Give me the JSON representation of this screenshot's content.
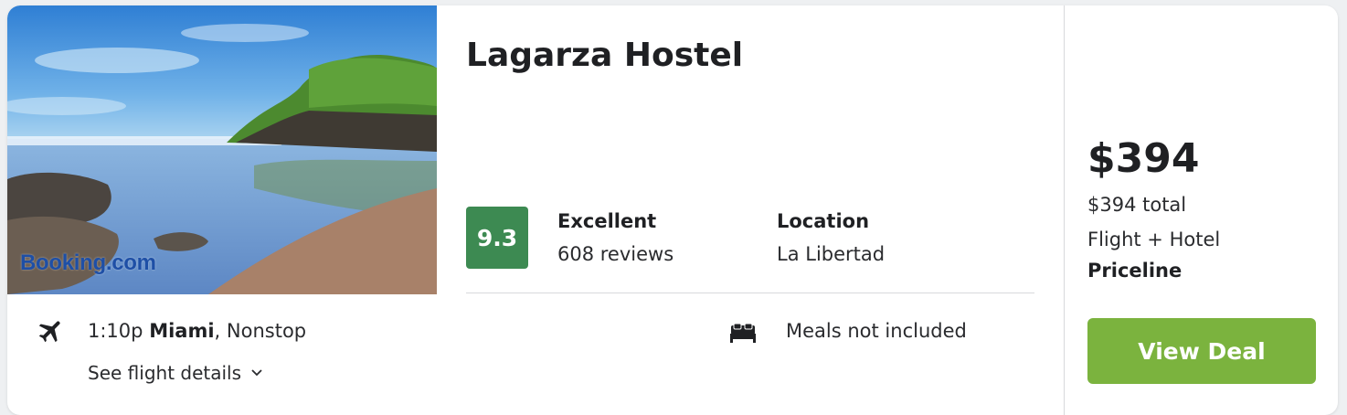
{
  "hotel": {
    "name": "Lagarza Hostel",
    "photo_watermark": "Booking.com",
    "score": "9.3",
    "rating_word": "Excellent",
    "review_count": "608 reviews",
    "location_label": "Location",
    "location_value": "La Libertad"
  },
  "flight": {
    "time": "1:10p",
    "origin": "Miami",
    "stops": ", Nonstop",
    "details_link": "See flight details",
    "icon": "airplane-icon"
  },
  "amenity": {
    "icon": "bed-icon",
    "text": "Meals not included"
  },
  "pricing": {
    "price": "$394",
    "total": "$394 total",
    "package": "Flight + Hotel",
    "provider": "Priceline",
    "cta_label": "View Deal"
  },
  "colors": {
    "score_badge": "#3d8a52",
    "cta_button": "#7bb33e"
  }
}
